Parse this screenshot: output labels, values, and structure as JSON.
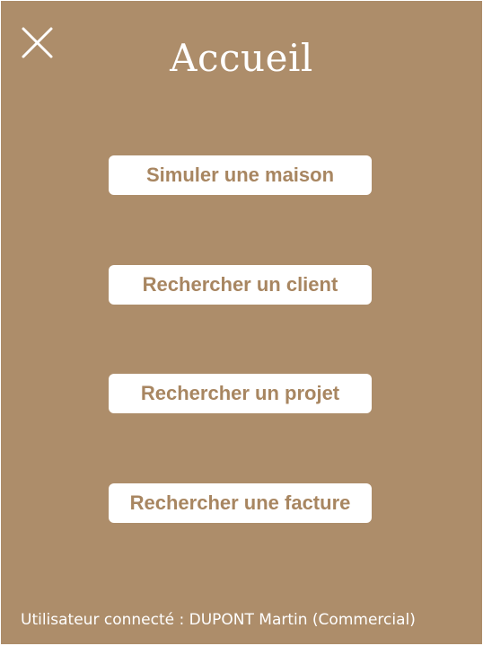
{
  "header": {
    "title": "Accueil",
    "close_icon": "close-icon"
  },
  "menu": {
    "buttons": [
      {
        "label": "Simuler une maison"
      },
      {
        "label": "Rechercher un client"
      },
      {
        "label": "Rechercher un projet"
      },
      {
        "label": "Rechercher une facture"
      }
    ]
  },
  "footer": {
    "status": "Utilisateur connecté : DUPONT Martin (Commercial)"
  },
  "colors": {
    "background": "#ad8d6a",
    "button_background": "#ffffff",
    "button_text": "#a88661",
    "foreground": "#ffffff"
  }
}
